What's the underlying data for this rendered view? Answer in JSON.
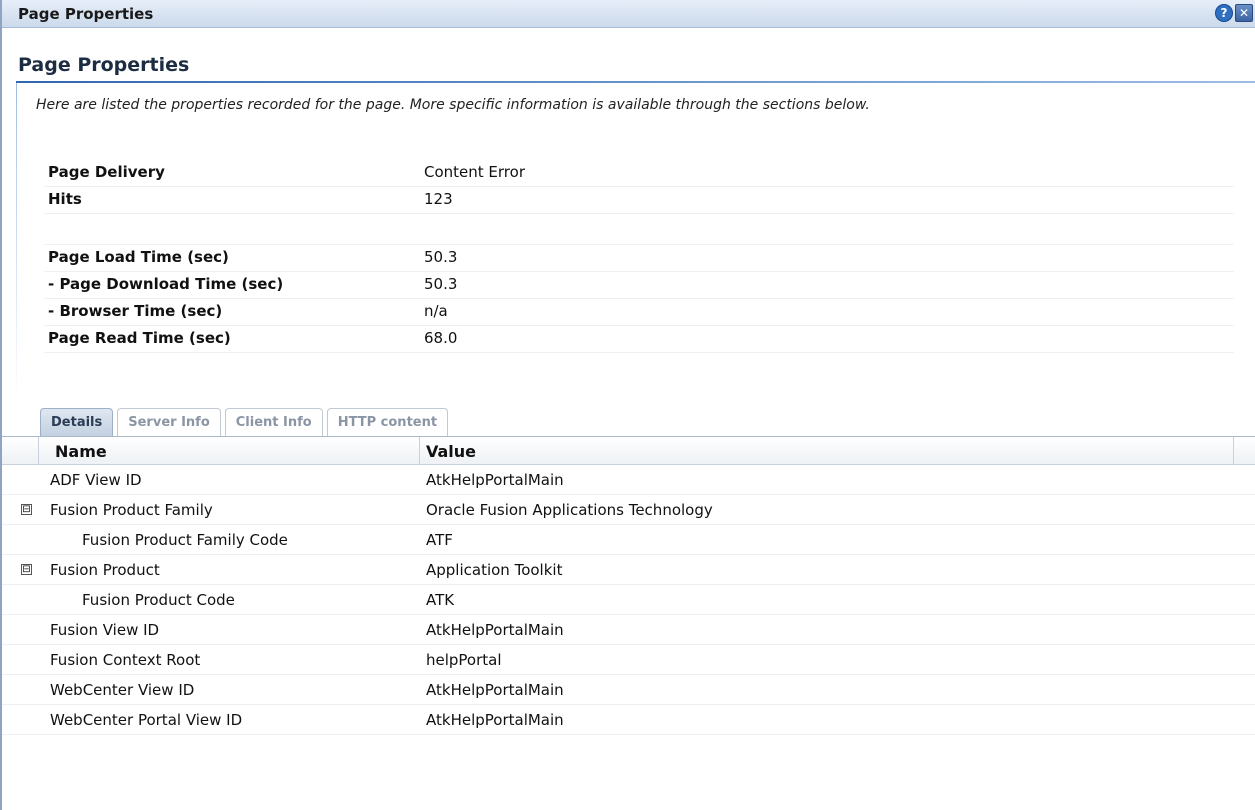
{
  "window": {
    "title": "Page Properties",
    "help_icon": "help-icon",
    "close_icon": "close-icon"
  },
  "header": {
    "heading": "Page Properties",
    "intro": "Here are listed the properties recorded for the page. More specific information is available through the sections below."
  },
  "properties": [
    {
      "label": "Page Delivery",
      "value": "Content Error"
    },
    {
      "label": "Hits",
      "value": "123"
    },
    {
      "label": "Page Load Time (sec)",
      "value": "50.3"
    },
    {
      "label": "- Page Download Time (sec)",
      "value": "50.3"
    },
    {
      "label": "- Browser Time (sec)",
      "value": "n/a"
    },
    {
      "label": "Page Read Time (sec)",
      "value": "68.0"
    }
  ],
  "tabs": [
    {
      "label": "Details",
      "active": true
    },
    {
      "label": "Server Info",
      "active": false
    },
    {
      "label": "Client Info",
      "active": false
    },
    {
      "label": "HTTP content",
      "active": false
    }
  ],
  "grid": {
    "columns": [
      "Name",
      "Value"
    ],
    "rows": [
      {
        "name": "ADF View ID",
        "value": "AtkHelpPortalMain"
      },
      {
        "name": "Fusion Product Family",
        "value": "Oracle Fusion Applications Technology",
        "expander": "⊟"
      },
      {
        "name": "Fusion Product Family Code",
        "value": "ATF"
      },
      {
        "name": "Fusion Product",
        "value": "Application Toolkit",
        "expander": "⊟"
      },
      {
        "name": "Fusion Product Code",
        "value": "ATK"
      },
      {
        "name": "Fusion View ID",
        "value": "AtkHelpPortalMain"
      },
      {
        "name": "Fusion Context Root",
        "value": "helpPortal"
      },
      {
        "name": "WebCenter View ID",
        "value": "AtkHelpPortalMain"
      },
      {
        "name": "WebCenter Portal View ID",
        "value": "AtkHelpPortalMain"
      }
    ]
  }
}
